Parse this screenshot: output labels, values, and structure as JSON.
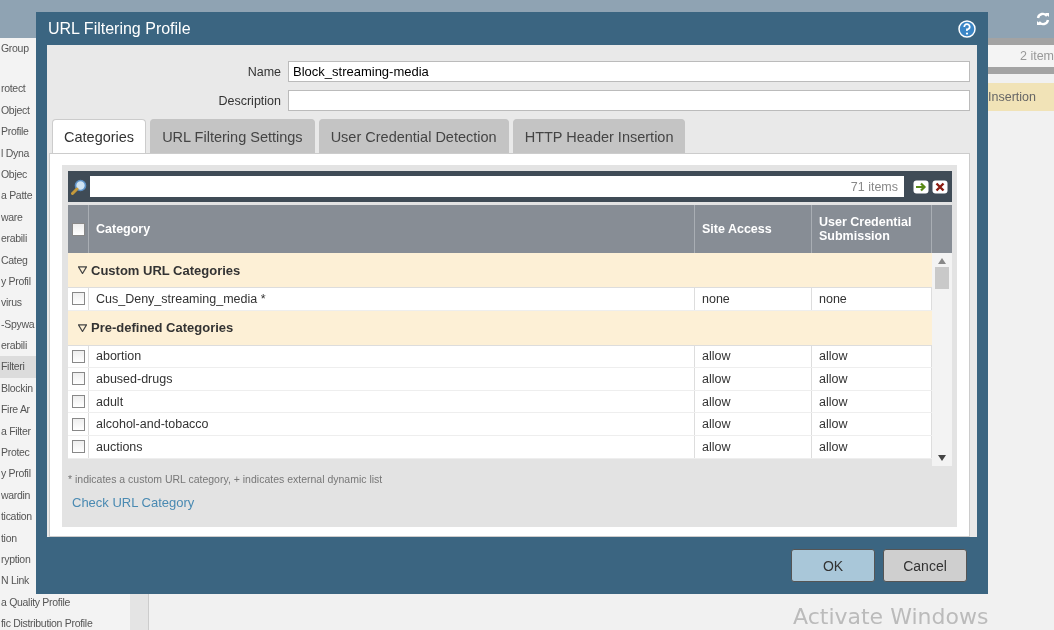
{
  "sidebar": {
    "items": [
      {
        "label": "Group",
        "selected": false
      },
      {
        "label": "rotect",
        "selected": false
      },
      {
        "label": "Object",
        "selected": false
      },
      {
        "label": "Profile",
        "selected": false
      },
      {
        "label": "l Dyna",
        "selected": false
      },
      {
        "label": "Objec",
        "selected": false
      },
      {
        "label": "a Patte",
        "selected": false
      },
      {
        "label": "ware",
        "selected": false
      },
      {
        "label": "erabili",
        "selected": false
      },
      {
        "label": "Categ",
        "selected": false
      },
      {
        "label": "y Profil",
        "selected": false
      },
      {
        "label": "virus",
        "selected": false
      },
      {
        "label": "-Spywa",
        "selected": false
      },
      {
        "label": "erabili",
        "selected": false
      },
      {
        "label": "Filteri",
        "selected": true
      },
      {
        "label": "Blockin",
        "selected": false
      },
      {
        "label": "Fire Ar",
        "selected": false
      },
      {
        "label": "a Filter",
        "selected": false
      },
      {
        "label": "Protec",
        "selected": false
      },
      {
        "label": "y Profil",
        "selected": false
      },
      {
        "label": "wardin",
        "selected": false
      },
      {
        "label": "tication",
        "selected": false
      },
      {
        "label": "tion",
        "selected": false
      },
      {
        "label": "ryption",
        "selected": false
      },
      {
        "label": "N Link",
        "selected": false
      },
      {
        "label": "a Quality Profile",
        "selected": false
      },
      {
        "label": "fic Distribution Profile",
        "selected": false
      }
    ]
  },
  "background_table": {
    "count": "2 item",
    "rows": [
      {
        "cell": "Insertion"
      }
    ]
  },
  "dialog": {
    "title": "URL Filtering Profile",
    "fields": [
      {
        "label": "Name",
        "value": "Block_streaming-media"
      },
      {
        "label": "Description"
      }
    ],
    "tabs": [
      {
        "label": "Categories",
        "selected": true
      },
      {
        "label": "URL Filtering Settings",
        "selected": false
      },
      {
        "label": "User Credential Detection",
        "selected": false
      },
      {
        "label": "HTTP Header Insertion",
        "selected": false
      }
    ],
    "grid": {
      "count": "71 items",
      "select_all": {
        "checked": false
      },
      "columns": [
        "Category",
        "Site Access",
        "User Credential Submission"
      ],
      "groups": [
        {
          "name": "Custom URL Categories",
          "expanded": true,
          "rows": [
            {
              "category": "Cus_Deny_streaming_media *",
              "site_access": "none",
              "user_credential": "none",
              "checked": false
            }
          ]
        },
        {
          "name": "Pre-defined Categories",
          "expanded": true,
          "rows": [
            {
              "category": "abortion",
              "site_access": "allow",
              "user_credential": "allow",
              "checked": false
            },
            {
              "category": "abused-drugs",
              "site_access": "allow",
              "user_credential": "allow",
              "checked": false
            },
            {
              "category": "adult",
              "site_access": "allow",
              "user_credential": "allow",
              "checked": false
            },
            {
              "category": "alcohol-and-tobacco",
              "site_access": "allow",
              "user_credential": "allow",
              "checked": false
            },
            {
              "category": "auctions",
              "site_access": "allow",
              "user_credential": "allow",
              "checked": false
            }
          ]
        }
      ]
    },
    "footnote": "* indicates a custom URL category, + indicates external dynamic list",
    "link": "Check URL Category",
    "buttons": [
      {
        "label": "OK",
        "kind": "primary"
      },
      {
        "label": "Cancel",
        "kind": "secondary"
      }
    ]
  },
  "os_notice": "Activate Windows"
}
